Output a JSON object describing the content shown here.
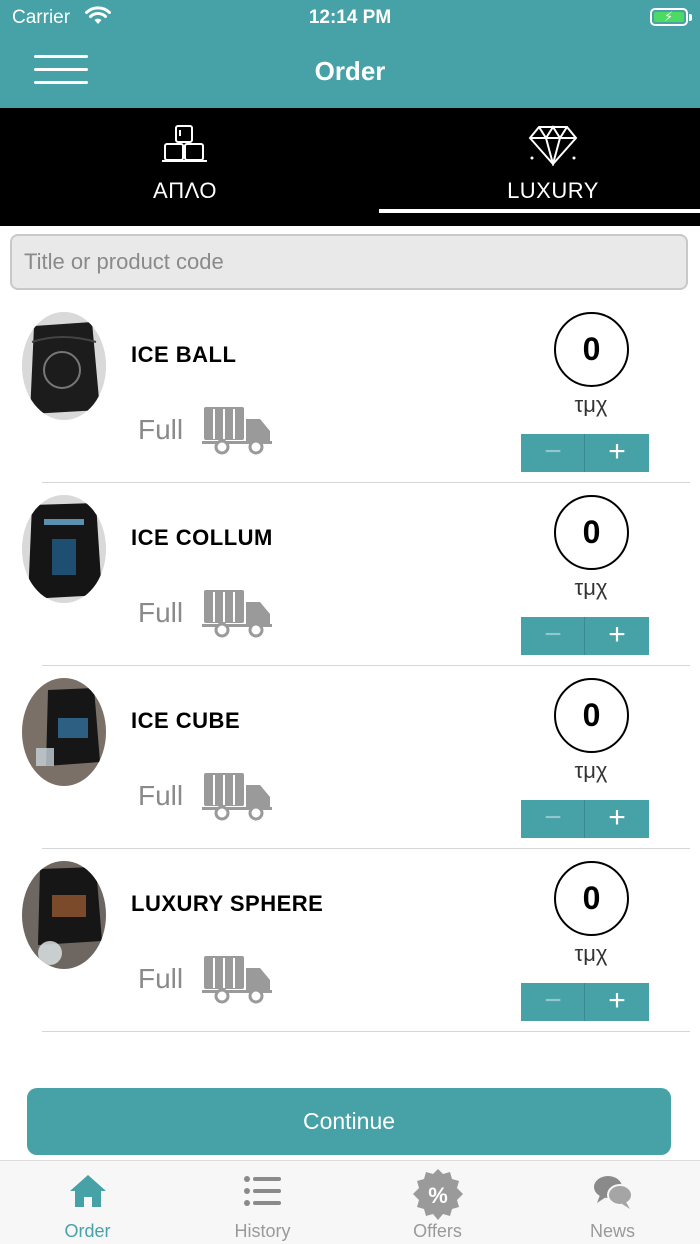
{
  "status_bar": {
    "carrier": "Carrier",
    "time": "12:14 PM"
  },
  "header": {
    "title": "Order"
  },
  "tabs": [
    {
      "label": "ΑΠΛΟ",
      "icon": "ice-cubes-icon",
      "selected": false
    },
    {
      "label": "LUXURY",
      "icon": "diamond-icon",
      "selected": true
    }
  ],
  "search": {
    "placeholder": "Title or product code",
    "value": ""
  },
  "products": [
    {
      "name": "ICE BALL",
      "delivery": "Full",
      "quantity": "0",
      "unit": "τμχ",
      "minus": "−",
      "plus": "+"
    },
    {
      "name": "ICE COLLUM",
      "delivery": "Full",
      "quantity": "0",
      "unit": "τμχ",
      "minus": "−",
      "plus": "+"
    },
    {
      "name": "ICE CUBE",
      "delivery": "Full",
      "quantity": "0",
      "unit": "τμχ",
      "minus": "−",
      "plus": "+"
    },
    {
      "name": "LUXURY SPHERE",
      "delivery": "Full",
      "quantity": "0",
      "unit": "τμχ",
      "minus": "−",
      "plus": "+"
    }
  ],
  "continue_button": {
    "label": "Continue"
  },
  "bottom_nav": [
    {
      "label": "Order",
      "icon": "home-icon",
      "active": true
    },
    {
      "label": "History",
      "icon": "list-icon",
      "active": false
    },
    {
      "label": "Offers",
      "icon": "percent-badge-icon",
      "active": false
    },
    {
      "label": "News",
      "icon": "chat-bubbles-icon",
      "active": false
    }
  ],
  "colors": {
    "accent": "#47a2a8",
    "tab_bar": "#000000",
    "battery": "#4cd964"
  }
}
